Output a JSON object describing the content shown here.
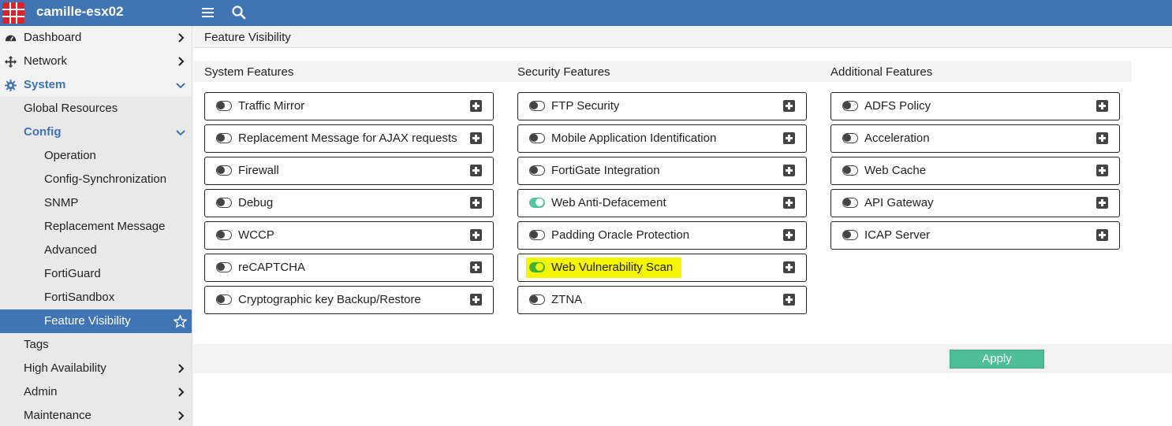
{
  "header": {
    "hostname": "camille-esx02"
  },
  "breadcrumb": "Feature Visibility",
  "sidebar": {
    "items": [
      {
        "label": "Dashboard"
      },
      {
        "label": "Network"
      },
      {
        "label": "System"
      },
      {
        "label": "Global Resources"
      },
      {
        "label": "Config"
      },
      {
        "label": "Operation"
      },
      {
        "label": "Config-Synchronization"
      },
      {
        "label": "SNMP"
      },
      {
        "label": "Replacement Message"
      },
      {
        "label": "Advanced"
      },
      {
        "label": "FortiGuard"
      },
      {
        "label": "FortiSandbox"
      },
      {
        "label": "Feature Visibility"
      },
      {
        "label": "Tags"
      },
      {
        "label": "High Availability"
      },
      {
        "label": "Admin"
      },
      {
        "label": "Maintenance"
      }
    ]
  },
  "columns": [
    {
      "title": "System Features",
      "features": [
        {
          "label": "Traffic Mirror",
          "enabled": false
        },
        {
          "label": "Replacement Message for AJAX requests",
          "enabled": false
        },
        {
          "label": "Firewall",
          "enabled": false
        },
        {
          "label": "Debug",
          "enabled": false
        },
        {
          "label": "WCCP",
          "enabled": false
        },
        {
          "label": "reCAPTCHA",
          "enabled": false
        },
        {
          "label": "Cryptographic key Backup/Restore",
          "enabled": false
        }
      ]
    },
    {
      "title": "Security Features",
      "features": [
        {
          "label": "FTP Security",
          "enabled": false
        },
        {
          "label": "Mobile Application Identification",
          "enabled": false
        },
        {
          "label": "FortiGate Integration",
          "enabled": false
        },
        {
          "label": "Web Anti-Defacement",
          "enabled": true
        },
        {
          "label": "Padding Oracle Protection",
          "enabled": false
        },
        {
          "label": "Web Vulnerability Scan",
          "enabled": true
        },
        {
          "label": "ZTNA",
          "enabled": false
        }
      ]
    },
    {
      "title": "Additional Features",
      "features": [
        {
          "label": "ADFS Policy",
          "enabled": false
        },
        {
          "label": "Acceleration",
          "enabled": false
        },
        {
          "label": "Web Cache",
          "enabled": false
        },
        {
          "label": "API Gateway",
          "enabled": false
        },
        {
          "label": "ICAP Server",
          "enabled": false
        }
      ]
    }
  ],
  "apply_label": "Apply",
  "colors": {
    "brand": "#3f74b5",
    "toggle_on": "#55c3a0",
    "apply": "#4fbf9a",
    "highlight": "#f5f500"
  }
}
